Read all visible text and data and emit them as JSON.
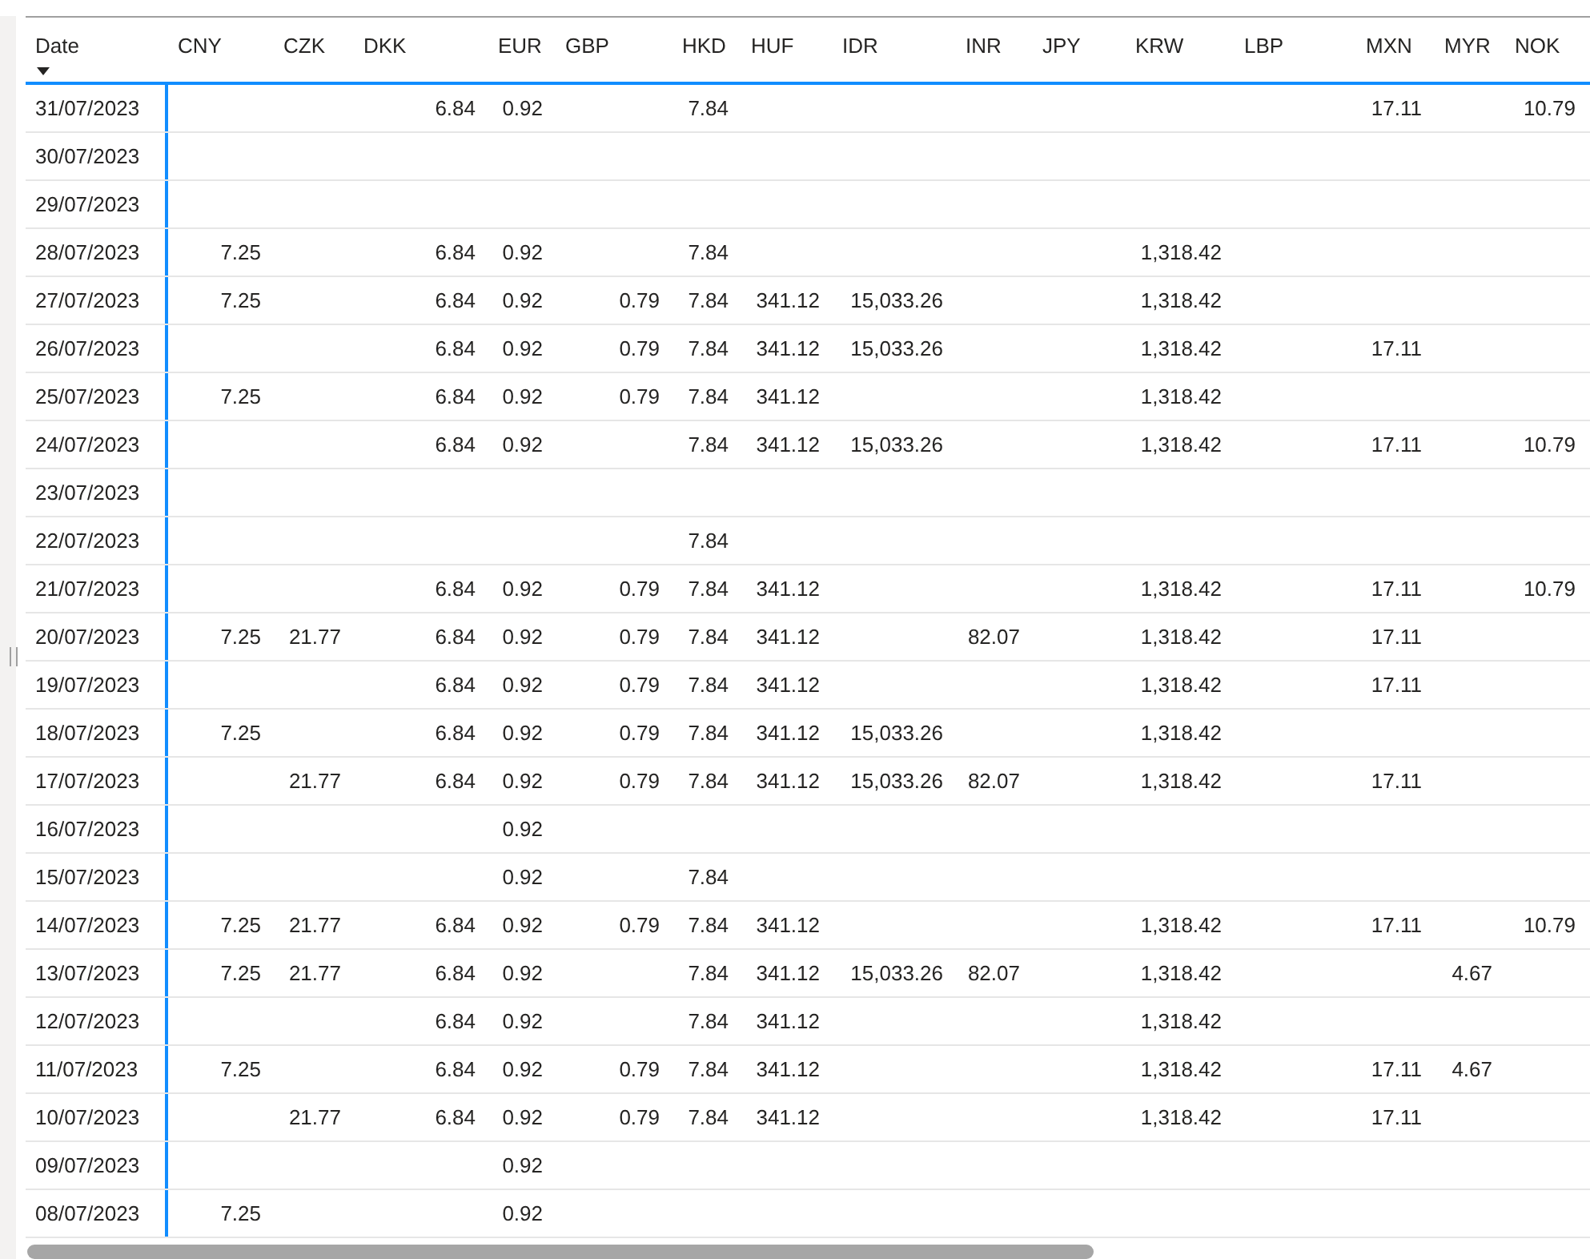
{
  "table": {
    "columns": [
      {
        "label": "Date",
        "sorted": true
      },
      {
        "label": "CNY",
        "sorted": false
      },
      {
        "label": "CZK",
        "sorted": false
      },
      {
        "label": "DKK",
        "sorted": false
      },
      {
        "label": "EUR",
        "sorted": false
      },
      {
        "label": "GBP",
        "sorted": false
      },
      {
        "label": "HKD",
        "sorted": false
      },
      {
        "label": "HUF",
        "sorted": false
      },
      {
        "label": "IDR",
        "sorted": false
      },
      {
        "label": "INR",
        "sorted": false
      },
      {
        "label": "JPY",
        "sorted": false
      },
      {
        "label": "KRW",
        "sorted": false
      },
      {
        "label": "LBP",
        "sorted": false
      },
      {
        "label": "MXN",
        "sorted": false
      },
      {
        "label": "MYR",
        "sorted": false
      },
      {
        "label": "NOK",
        "sorted": false
      }
    ],
    "rows": [
      {
        "cells": [
          "31/07/2023",
          null,
          null,
          "6.84",
          "0.92",
          null,
          "7.84",
          null,
          null,
          null,
          null,
          null,
          null,
          "17.11",
          null,
          "10.79"
        ]
      },
      {
        "cells": [
          "30/07/2023",
          null,
          null,
          null,
          null,
          null,
          null,
          null,
          null,
          null,
          null,
          null,
          null,
          null,
          null,
          null
        ]
      },
      {
        "cells": [
          "29/07/2023",
          null,
          null,
          null,
          null,
          null,
          null,
          null,
          null,
          null,
          null,
          null,
          null,
          null,
          null,
          null
        ]
      },
      {
        "cells": [
          "28/07/2023",
          "7.25",
          null,
          "6.84",
          "0.92",
          null,
          "7.84",
          null,
          null,
          null,
          null,
          "1,318.42",
          null,
          null,
          null,
          null
        ]
      },
      {
        "cells": [
          "27/07/2023",
          "7.25",
          null,
          "6.84",
          "0.92",
          "0.79",
          "7.84",
          "341.12",
          "15,033.26",
          null,
          null,
          "1,318.42",
          null,
          null,
          null,
          null
        ]
      },
      {
        "cells": [
          "26/07/2023",
          null,
          null,
          "6.84",
          "0.92",
          "0.79",
          "7.84",
          "341.12",
          "15,033.26",
          null,
          null,
          "1,318.42",
          null,
          "17.11",
          null,
          null
        ]
      },
      {
        "cells": [
          "25/07/2023",
          "7.25",
          null,
          "6.84",
          "0.92",
          "0.79",
          "7.84",
          "341.12",
          null,
          null,
          null,
          "1,318.42",
          null,
          null,
          null,
          null
        ]
      },
      {
        "cells": [
          "24/07/2023",
          null,
          null,
          "6.84",
          "0.92",
          null,
          "7.84",
          "341.12",
          "15,033.26",
          null,
          null,
          "1,318.42",
          null,
          "17.11",
          null,
          "10.79"
        ]
      },
      {
        "cells": [
          "23/07/2023",
          null,
          null,
          null,
          null,
          null,
          null,
          null,
          null,
          null,
          null,
          null,
          null,
          null,
          null,
          null
        ]
      },
      {
        "cells": [
          "22/07/2023",
          null,
          null,
          null,
          null,
          null,
          "7.84",
          null,
          null,
          null,
          null,
          null,
          null,
          null,
          null,
          null
        ]
      },
      {
        "cells": [
          "21/07/2023",
          null,
          null,
          "6.84",
          "0.92",
          "0.79",
          "7.84",
          "341.12",
          null,
          null,
          null,
          "1,318.42",
          null,
          "17.11",
          null,
          "10.79"
        ]
      },
      {
        "cells": [
          "20/07/2023",
          "7.25",
          "21.77",
          "6.84",
          "0.92",
          "0.79",
          "7.84",
          "341.12",
          null,
          "82.07",
          null,
          "1,318.42",
          null,
          "17.11",
          null,
          null
        ]
      },
      {
        "cells": [
          "19/07/2023",
          null,
          null,
          "6.84",
          "0.92",
          "0.79",
          "7.84",
          "341.12",
          null,
          null,
          null,
          "1,318.42",
          null,
          "17.11",
          null,
          null
        ]
      },
      {
        "cells": [
          "18/07/2023",
          "7.25",
          null,
          "6.84",
          "0.92",
          "0.79",
          "7.84",
          "341.12",
          "15,033.26",
          null,
          null,
          "1,318.42",
          null,
          null,
          null,
          null
        ]
      },
      {
        "cells": [
          "17/07/2023",
          null,
          "21.77",
          "6.84",
          "0.92",
          "0.79",
          "7.84",
          "341.12",
          "15,033.26",
          "82.07",
          null,
          "1,318.42",
          null,
          "17.11",
          null,
          null
        ]
      },
      {
        "cells": [
          "16/07/2023",
          null,
          null,
          null,
          "0.92",
          null,
          null,
          null,
          null,
          null,
          null,
          null,
          null,
          null,
          null,
          null
        ]
      },
      {
        "cells": [
          "15/07/2023",
          null,
          null,
          null,
          "0.92",
          null,
          "7.84",
          null,
          null,
          null,
          null,
          null,
          null,
          null,
          null,
          null
        ]
      },
      {
        "cells": [
          "14/07/2023",
          "7.25",
          "21.77",
          "6.84",
          "0.92",
          "0.79",
          "7.84",
          "341.12",
          null,
          null,
          null,
          "1,318.42",
          null,
          "17.11",
          null,
          "10.79"
        ]
      },
      {
        "cells": [
          "13/07/2023",
          "7.25",
          "21.77",
          "6.84",
          "0.92",
          null,
          "7.84",
          "341.12",
          "15,033.26",
          "82.07",
          null,
          "1,318.42",
          null,
          null,
          "4.67",
          null
        ]
      },
      {
        "cells": [
          "12/07/2023",
          null,
          null,
          "6.84",
          "0.92",
          null,
          "7.84",
          "341.12",
          null,
          null,
          null,
          "1,318.42",
          null,
          null,
          null,
          null
        ]
      },
      {
        "cells": [
          "11/07/2023",
          "7.25",
          null,
          "6.84",
          "0.92",
          "0.79",
          "7.84",
          "341.12",
          null,
          null,
          null,
          "1,318.42",
          null,
          "17.11",
          "4.67",
          null
        ]
      },
      {
        "cells": [
          "10/07/2023",
          null,
          "21.77",
          "6.84",
          "0.92",
          "0.79",
          "7.84",
          "341.12",
          null,
          null,
          null,
          "1,318.42",
          null,
          "17.11",
          null,
          null
        ]
      },
      {
        "cells": [
          "09/07/2023",
          null,
          null,
          null,
          "0.92",
          null,
          null,
          null,
          null,
          null,
          null,
          null,
          null,
          null,
          null,
          null
        ]
      },
      {
        "cells": [
          "08/07/2023",
          "7.25",
          null,
          null,
          "0.92",
          null,
          null,
          null,
          null,
          null,
          null,
          null,
          null,
          null,
          null,
          null
        ]
      }
    ]
  }
}
